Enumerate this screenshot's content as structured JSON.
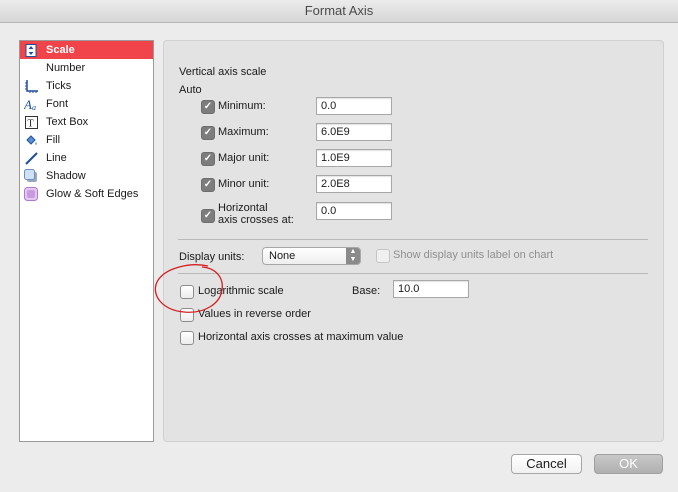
{
  "window": {
    "title": "Format Axis"
  },
  "sidebar": {
    "items": [
      {
        "label": "Scale",
        "icon": "scale-icon",
        "selected": true
      },
      {
        "label": "Number",
        "icon": "",
        "selected": false
      },
      {
        "label": "Ticks",
        "icon": "ticks-icon",
        "selected": false
      },
      {
        "label": "Font",
        "icon": "font-icon",
        "selected": false
      },
      {
        "label": "Text Box",
        "icon": "text-box-icon",
        "selected": false
      },
      {
        "label": "Fill",
        "icon": "fill-bucket-icon",
        "selected": false
      },
      {
        "label": "Line",
        "icon": "line-icon",
        "selected": false
      },
      {
        "label": "Shadow",
        "icon": "shadow-icon",
        "selected": false
      },
      {
        "label": "Glow & Soft Edges",
        "icon": "glow-icon",
        "selected": false
      }
    ]
  },
  "scale": {
    "heading": "Vertical axis scale",
    "auto_label": "Auto",
    "minimum": {
      "label": "Minimum:",
      "value": "0.0",
      "auto": true
    },
    "maximum": {
      "label": "Maximum:",
      "value": "6.0E9",
      "auto": true
    },
    "major_unit": {
      "label": "Major unit:",
      "value": "1.0E9",
      "auto": true
    },
    "minor_unit": {
      "label": "Minor unit:",
      "value": "2.0E8",
      "auto": true
    },
    "horizontal_crosses": {
      "label_line1": "Horizontal",
      "label_line2": "axis crosses at:",
      "value": "0.0",
      "auto": true
    }
  },
  "display_units": {
    "label": "Display units:",
    "selected": "None",
    "show_label_text": "Show display units label on chart",
    "show_label_checked": false,
    "show_label_enabled": false
  },
  "options": {
    "logarithmic": {
      "label": "Logarithmic scale",
      "checked": false
    },
    "base": {
      "label": "Base:",
      "value": "10.0"
    },
    "reverse_order": {
      "label": "Values in reverse order",
      "checked": false
    },
    "crosses_max": {
      "label": "Horizontal axis crosses at maximum value",
      "checked": false
    }
  },
  "buttons": {
    "cancel": "Cancel",
    "ok": "OK"
  },
  "annotation": {
    "color": "#d42020"
  },
  "colors": {
    "selection": "#f1434a"
  }
}
